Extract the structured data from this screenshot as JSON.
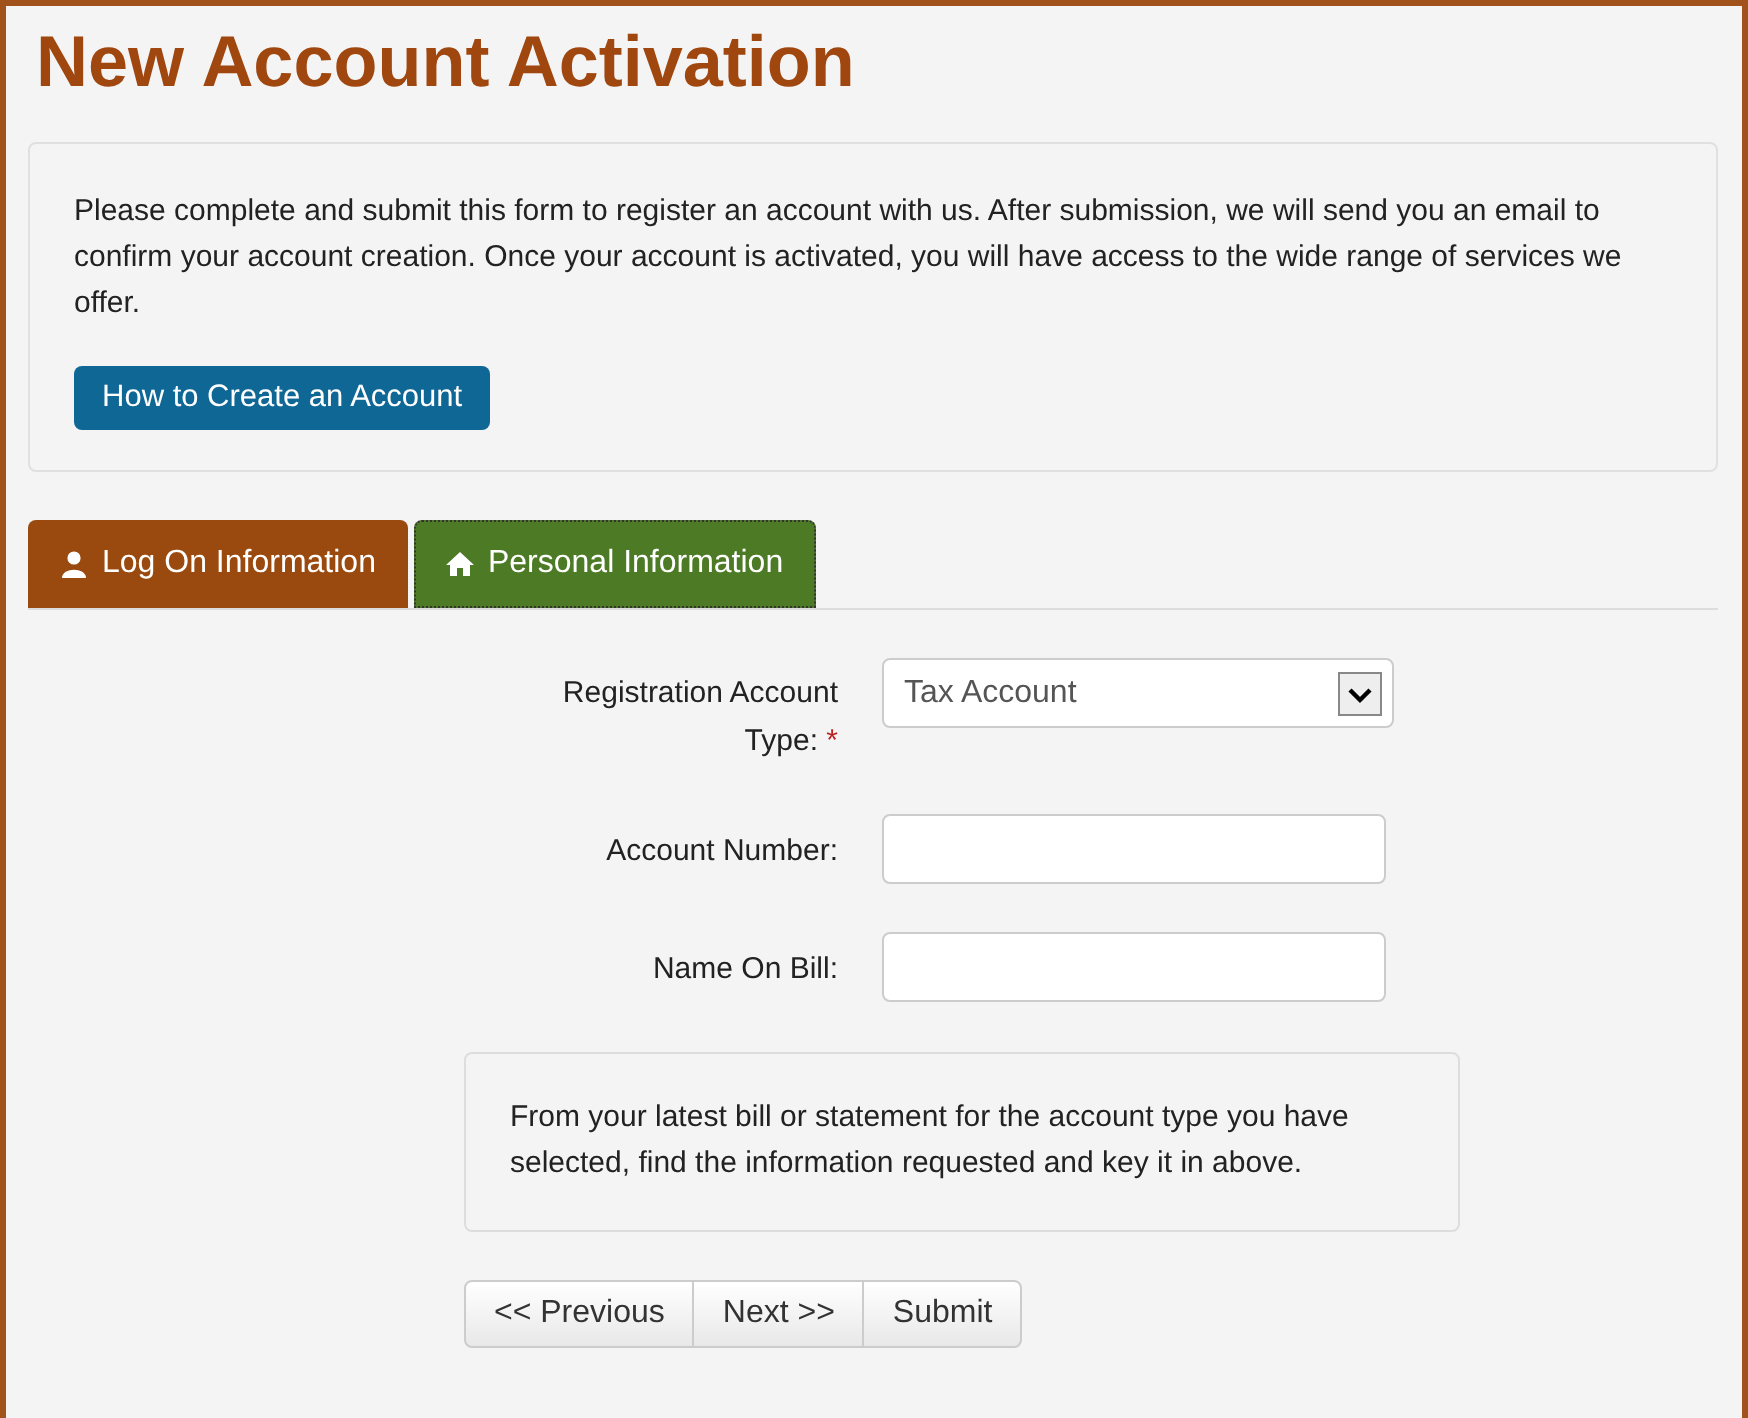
{
  "title": "New Account Activation",
  "intro": {
    "text": "Please complete and submit this form to register an account with us. After submission, we will send you an email to confirm your account creation. Once your account is activated, you will have access to the wide range of services we offer.",
    "button": "How to Create an Account"
  },
  "tabs": [
    {
      "label": "Log On Information",
      "kind": "person",
      "selected": false
    },
    {
      "label": "Personal Information",
      "kind": "home",
      "selected": true
    }
  ],
  "fields": [
    {
      "kind": "select",
      "label": "Registration Account Type:",
      "required_mark": "*",
      "value": "Tax Account"
    },
    {
      "kind": "text",
      "label": "Account Number:"
    },
    {
      "kind": "text",
      "label": "Name On Bill:"
    }
  ],
  "note": "From your latest bill or statement for the account type you have selected, find the information requested and key it in above.",
  "buttons": [
    "<< Previous",
    "Next >>",
    "Submit"
  ]
}
